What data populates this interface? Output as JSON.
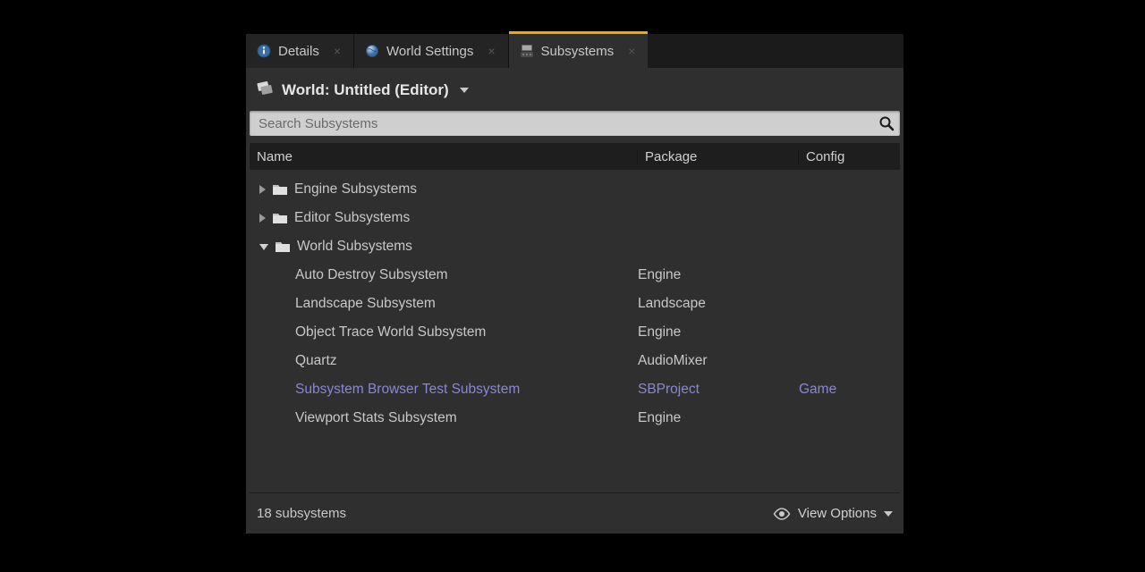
{
  "tabs": [
    {
      "label": "Details"
    },
    {
      "label": "World Settings"
    },
    {
      "label": "Subsystems",
      "active": true
    }
  ],
  "header": {
    "title": "World: Untitled (Editor)"
  },
  "search": {
    "placeholder": "Search Subsystems"
  },
  "columns": {
    "name": "Name",
    "package": "Package",
    "config": "Config"
  },
  "groups": [
    {
      "label": "Engine Subsystems",
      "expanded": false,
      "children": []
    },
    {
      "label": "Editor Subsystems",
      "expanded": false,
      "children": []
    },
    {
      "label": "World Subsystems",
      "expanded": true,
      "children": [
        {
          "name": "Auto Destroy Subsystem",
          "package": "Engine",
          "config": ""
        },
        {
          "name": "Landscape Subsystem",
          "package": "Landscape",
          "config": ""
        },
        {
          "name": "Object Trace World Subsystem",
          "package": "Engine",
          "config": ""
        },
        {
          "name": "Quartz",
          "package": "AudioMixer",
          "config": ""
        },
        {
          "name": "Subsystem Browser Test Subsystem",
          "package": "SBProject",
          "config": "Game",
          "highlight": true
        },
        {
          "name": "Viewport Stats Subsystem",
          "package": "Engine",
          "config": ""
        }
      ]
    }
  ],
  "footer": {
    "count": "18 subsystems",
    "view_options": "View Options"
  }
}
